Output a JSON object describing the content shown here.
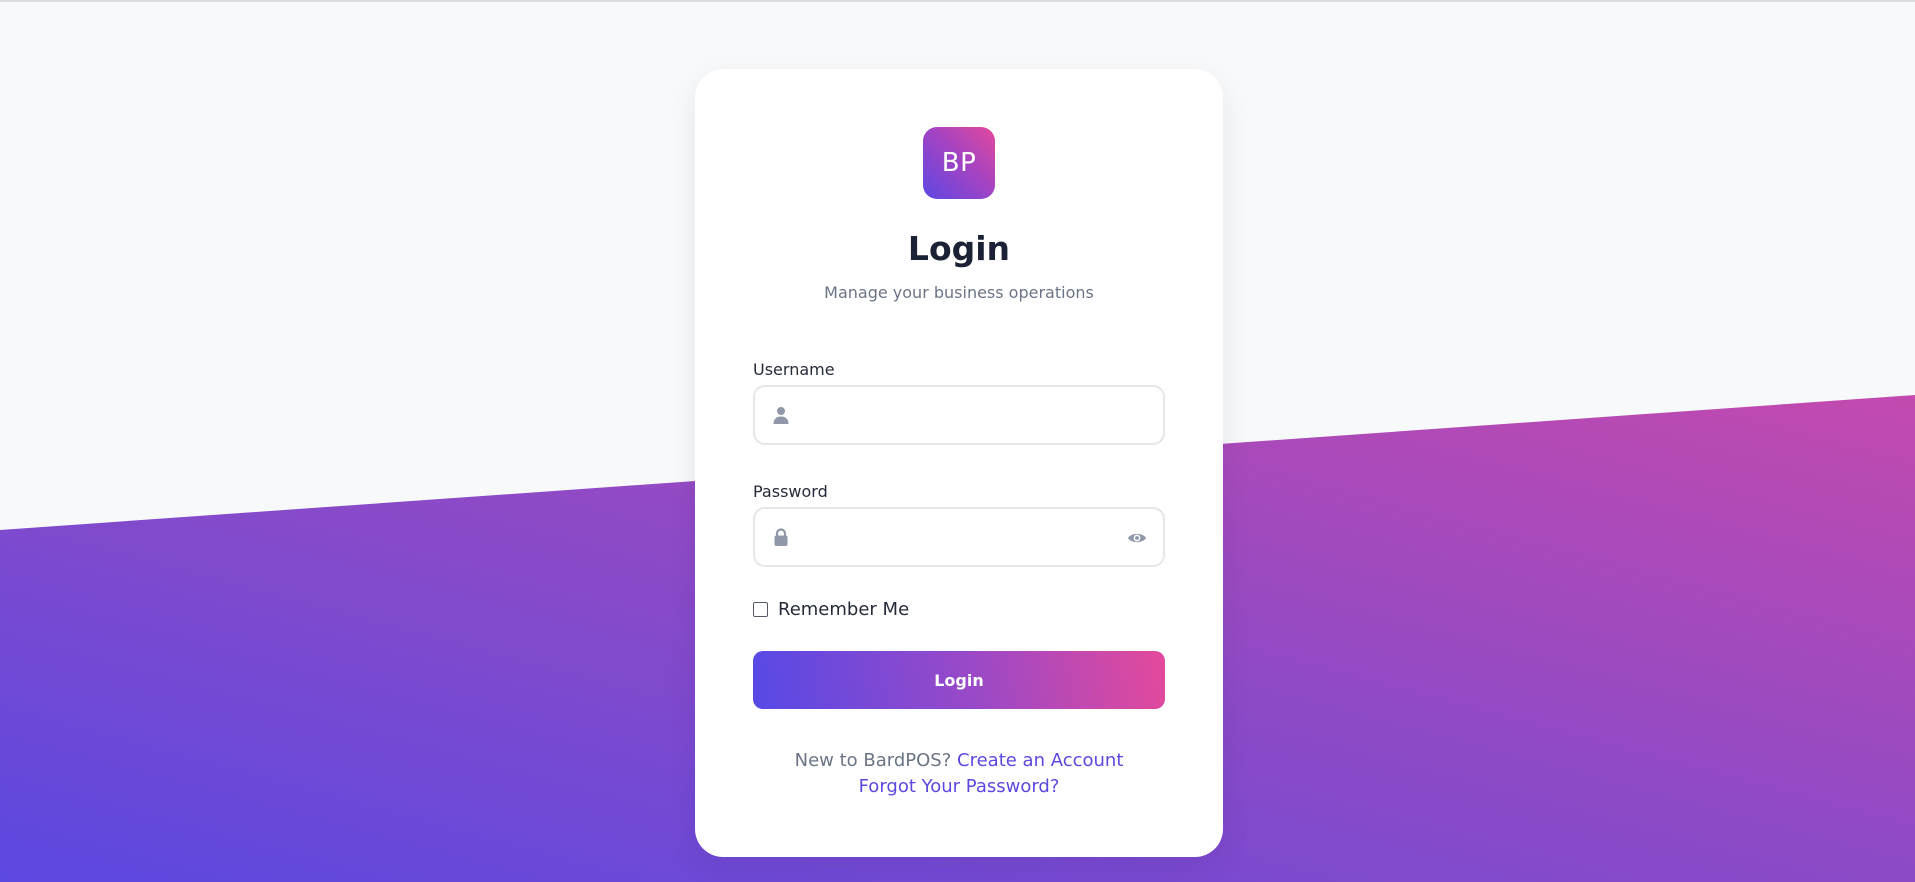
{
  "brand": {
    "logo_text": "BP",
    "gradient_start": "#5d47e2",
    "gradient_end": "#e4499d"
  },
  "login": {
    "title": "Login",
    "subtitle": "Manage your business operations",
    "username": {
      "label": "Username",
      "value": "",
      "placeholder": "",
      "icon": "user-icon"
    },
    "password": {
      "label": "Password",
      "value": "",
      "placeholder": "",
      "icon": "lock-icon",
      "toggle_icon": "eye-icon"
    },
    "remember_me": {
      "label": "Remember Me",
      "checked": false
    },
    "submit_label": "Login",
    "signup_prompt": "New to BardPOS?",
    "signup_link": "Create an Account",
    "forgot_link": "Forgot Your Password?"
  },
  "colors": {
    "page_background": "#f8f9fa",
    "card_background": "#ffffff",
    "title_color": "#1b2236",
    "muted_text": "#6b7486",
    "link_color": "#5a49e0",
    "icon_color": "#8f97a8",
    "border_color": "#e4e6ea"
  }
}
